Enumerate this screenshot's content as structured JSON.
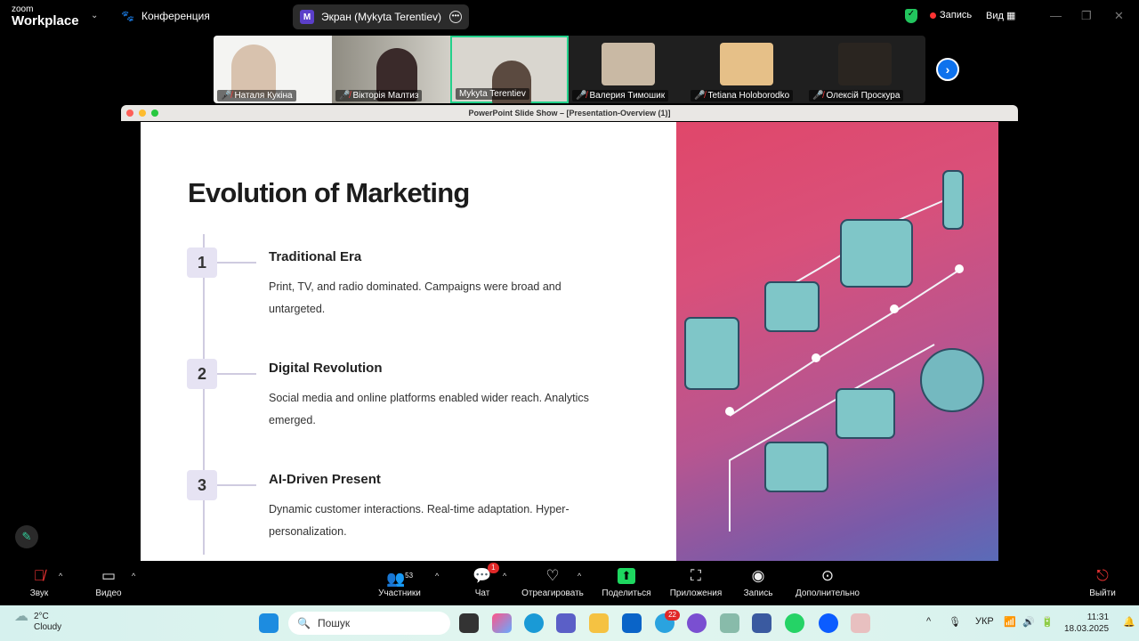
{
  "app": {
    "logo_small": "zoom",
    "logo_big": "Workplace",
    "meeting_label": "Конференция",
    "screen_badge": "M",
    "screen_share": "Экран (Mykyta Terentiev)",
    "record_label": "Запись",
    "view_label": "Вид"
  },
  "participants": [
    {
      "name": "Наталя Кукіна",
      "muted": true
    },
    {
      "name": "Вікторія Малтиз",
      "muted": true
    },
    {
      "name": "Mykyta Terentiev",
      "muted": false,
      "active": true
    },
    {
      "name": "Валерия Тимошик",
      "muted": true
    },
    {
      "name": "Tetiana Holoborodko",
      "muted": true
    },
    {
      "name": "Олексій Проскура",
      "muted": true
    }
  ],
  "window": {
    "title": "PowerPoint Slide Show – [Presentation-Overview (1)]"
  },
  "slide": {
    "title": "Evolution of Marketing",
    "steps": [
      {
        "num": "1",
        "heading": "Traditional Era",
        "desc": "Print, TV, and radio dominated. Campaigns were broad and untargeted."
      },
      {
        "num": "2",
        "heading": "Digital Revolution",
        "desc": "Social media and online platforms enabled wider reach. Analytics emerged."
      },
      {
        "num": "3",
        "heading": "AI-Driven Present",
        "desc": "Dynamic customer interactions. Real-time adaptation. Hyper-personalization."
      }
    ]
  },
  "toolbar": {
    "audio": "Звук",
    "video": "Видео",
    "participants": "Участники",
    "participants_count": "53",
    "chat": "Чат",
    "chat_badge": "1",
    "react": "Отреагировать",
    "share": "Поделиться",
    "apps": "Приложения",
    "record": "Запись",
    "more": "Дополнительно",
    "leave": "Выйти"
  },
  "taskbar": {
    "temp": "2°C",
    "weather": "Cloudy",
    "search_placeholder": "Пошук",
    "telegram_badge": "22",
    "lang": "УКР",
    "time": "11:31",
    "date": "18.03.2025"
  }
}
